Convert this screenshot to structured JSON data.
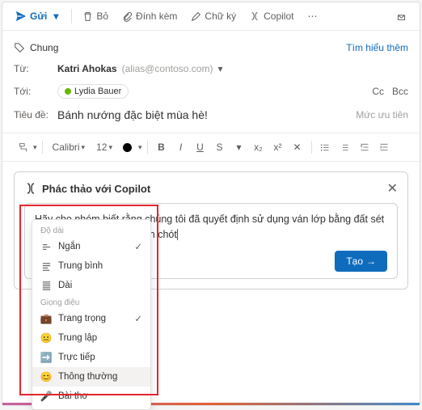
{
  "toolbar": {
    "send": "Gửi",
    "discard": "Bỏ",
    "attach": "Đính kèm",
    "signature": "Chữ ký",
    "copilot": "Copilot"
  },
  "header": {
    "tag_label": "Chung",
    "learn_more": "Tìm hiểu thêm",
    "from_label": "Từ:",
    "from_name": "Katri Ahokas",
    "from_email": "(alias@contoso.com)",
    "to_label": "Tới:",
    "to_person": "Lydia Bauer",
    "cc": "Cc",
    "bcc": "Bcc",
    "subject_label": "Tiêu đề:",
    "subject": "Bánh nướng đặc biệt mùa hè!",
    "priority": "Mức ưu tiên"
  },
  "format": {
    "font": "Calibri",
    "size": "12"
  },
  "copilot": {
    "title": "Phác thảo với Copilot",
    "prompt": "Hãy cho nhóm biết rằng chúng tôi đã quyết định sử dụng ván lớp bằng đất sét và tiếp tục để đáp ứng hạn chót",
    "generate": "Tạo"
  },
  "dropdown": {
    "length_label": "Độ dài",
    "length": [
      "Ngắn",
      "Trung bình",
      "Dài"
    ],
    "length_selected": 0,
    "tone_label": "Giọng điệu",
    "tone": [
      "Trang trọng",
      "Trung lập",
      "Trực tiếp",
      "Thông thường",
      "Bài thơ"
    ],
    "tone_selected": 0,
    "tone_hover": 3
  }
}
